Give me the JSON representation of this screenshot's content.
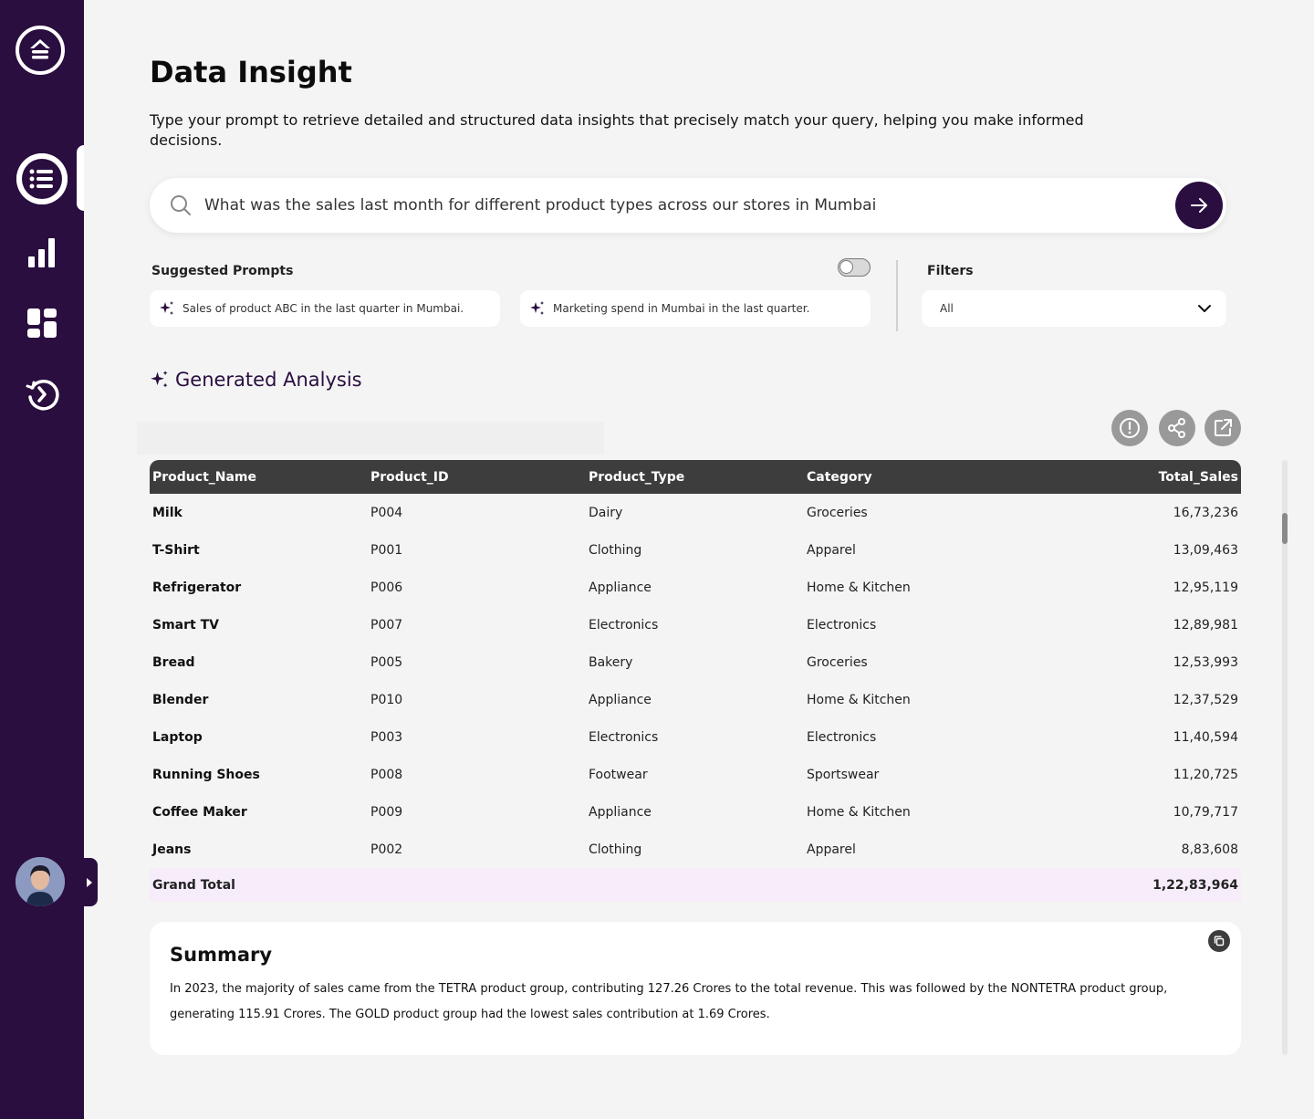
{
  "page": {
    "title": "Data Insight",
    "description": "Type your prompt to retrieve detailed and structured data insights that precisely match your query, helping you make informed decisions."
  },
  "search": {
    "value": "What was the sales last month for different product types across our stores in Mumbai",
    "placeholder": ""
  },
  "suggested": {
    "label": "Suggested Prompts",
    "prompts": [
      "Sales of product ABC in the last quarter in Mumbai.",
      "Marketing spend in Mumbai in the last quarter."
    ]
  },
  "filters": {
    "label": "Filters",
    "selected": "All"
  },
  "analysis": {
    "title": "Generated Analysis"
  },
  "table": {
    "headers": [
      "Product_Name",
      "Product_ID",
      "Product_Type",
      "Category",
      "Total_Sales"
    ],
    "rows": [
      [
        "Milk",
        "P004",
        "Dairy",
        "Groceries",
        "16,73,236"
      ],
      [
        "T-Shirt",
        "P001",
        "Clothing",
        "Apparel",
        "13,09,463"
      ],
      [
        "Refrigerator",
        "P006",
        "Appliance",
        "Home & Kitchen",
        "12,95,119"
      ],
      [
        "Smart TV",
        "P007",
        "Electronics",
        "Electronics",
        "12,89,981"
      ],
      [
        "Bread",
        "P005",
        "Bakery",
        "Groceries",
        "12,53,993"
      ],
      [
        "Blender",
        "P010",
        "Appliance",
        "Home & Kitchen",
        "12,37,529"
      ],
      [
        "Laptop",
        "P003",
        "Electronics",
        "Electronics",
        "11,40,594"
      ],
      [
        "Running Shoes",
        "P008",
        "Footwear",
        "Sportswear",
        "11,20,725"
      ],
      [
        "Coffee Maker",
        "P009",
        "Appliance",
        "Home & Kitchen",
        "10,79,717"
      ],
      [
        "Jeans",
        "P002",
        "Clothing",
        "Apparel",
        "8,83,608"
      ]
    ],
    "total_label": "Grand Total",
    "total_value": "1,22,83,964"
  },
  "summary": {
    "title": "Summary",
    "text": "In 2023, the majority of sales came from the TETRA product group, contributing 127.26 Crores to the total revenue. This was followed by the NONTETRA product group, generating 115.91 Crores. The GOLD product group had the lowest sales contribution at 1.69 Crores."
  },
  "colors": {
    "sidebar": "#2a0e3f",
    "accent": "#2a0e3f",
    "table_header": "#3d3d3d",
    "total_row": "#f6ecfa"
  },
  "icons": {
    "logo": "upload-circle-icon",
    "nav": [
      "list-icon",
      "bar-chart-icon",
      "dashboard-icon",
      "history-icon"
    ],
    "actions": [
      "info-icon",
      "share-icon",
      "external-link-icon"
    ]
  }
}
